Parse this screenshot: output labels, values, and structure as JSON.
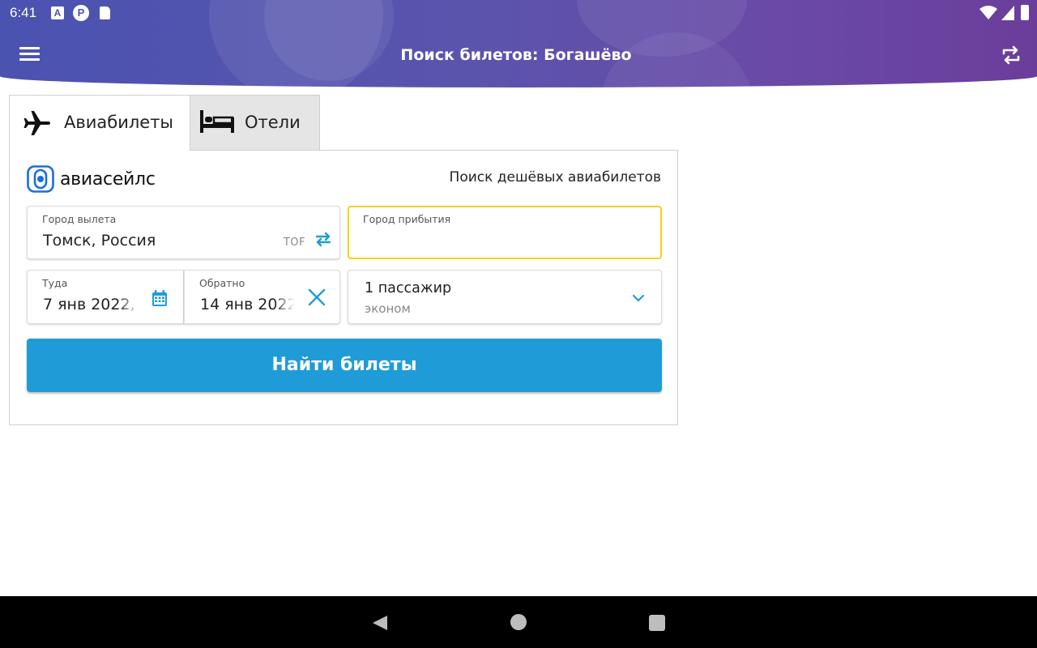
{
  "status_bar": {
    "time": "6:41",
    "icons": [
      "a-notification-icon",
      "p-notification-icon",
      "sd-card-icon",
      "wifi-icon",
      "signal-icon",
      "battery-icon"
    ]
  },
  "app_bar": {
    "title": "Поиск билетов: Богашёво",
    "menu_icon": "hamburger-menu-icon",
    "swap_icon": "swap-arrows-icon"
  },
  "tabs": [
    {
      "label": "Авиабилеты",
      "icon": "airplane-icon",
      "active": true
    },
    {
      "label": "Отели",
      "icon": "bed-icon",
      "active": false
    }
  ],
  "brand": {
    "logo_text": "авиасейлс",
    "tagline": "Поиск дешёвых авиабилетов",
    "accent": "#1f9cd8",
    "focus_border": "#f2d11d"
  },
  "form": {
    "origin": {
      "label": "Город вылета",
      "value": "Томск, Россия",
      "iata": "TOF"
    },
    "destination": {
      "label": "Город прибытия",
      "value": ""
    },
    "depart": {
      "label": "Туда",
      "value": "7 янв 2022,"
    },
    "return": {
      "label": "Обратно",
      "value": "14 янв 2022"
    },
    "passengers": {
      "count": "1 пассажир",
      "class": "эконом"
    },
    "search_button": "Найти билеты"
  },
  "nav_bar": {
    "icons": [
      "back-icon",
      "home-icon",
      "recents-icon"
    ]
  }
}
